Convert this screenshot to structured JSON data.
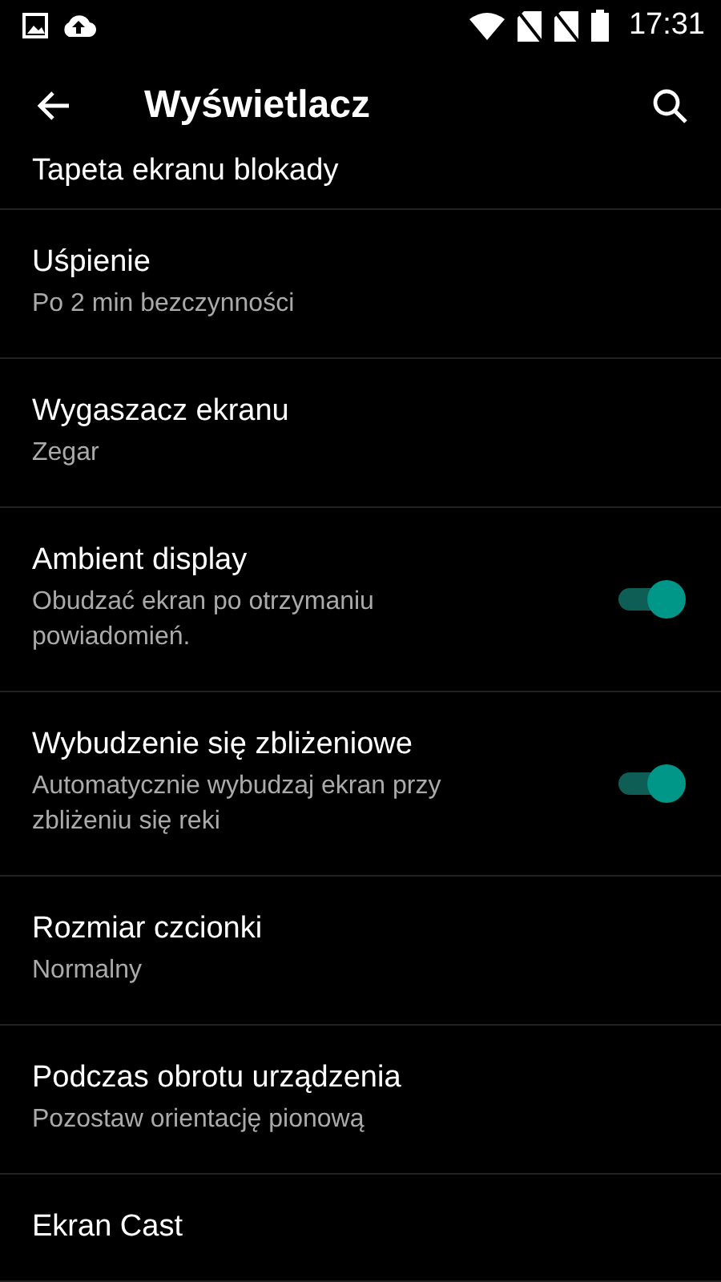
{
  "status_bar": {
    "time": "17:31"
  },
  "toolbar": {
    "title": "Wyświetlacz"
  },
  "settings": [
    {
      "kind": "plain",
      "title": "Tapeta ekranu blokady"
    },
    {
      "kind": "plain",
      "title": "Uśpienie",
      "summary": "Po 2 min bezczynności"
    },
    {
      "kind": "plain",
      "title": "Wygaszacz ekranu",
      "summary": "Zegar"
    },
    {
      "kind": "switch",
      "title": "Ambient display",
      "summary": "Obudzać ekran po otrzymaniu powiadomień.",
      "on": true
    },
    {
      "kind": "switch",
      "title": "Wybudzenie się zbliżeniowe",
      "summary": "Automatycznie wybudzaj ekran przy zbliżeniu się reki",
      "on": true
    },
    {
      "kind": "plain",
      "title": "Rozmiar czcionki",
      "summary": "Normalny"
    },
    {
      "kind": "plain",
      "title": "Podczas obrotu urządzenia",
      "summary": "Pozostaw orientację pionową"
    },
    {
      "kind": "plain",
      "title": "Ekran Cast"
    }
  ]
}
